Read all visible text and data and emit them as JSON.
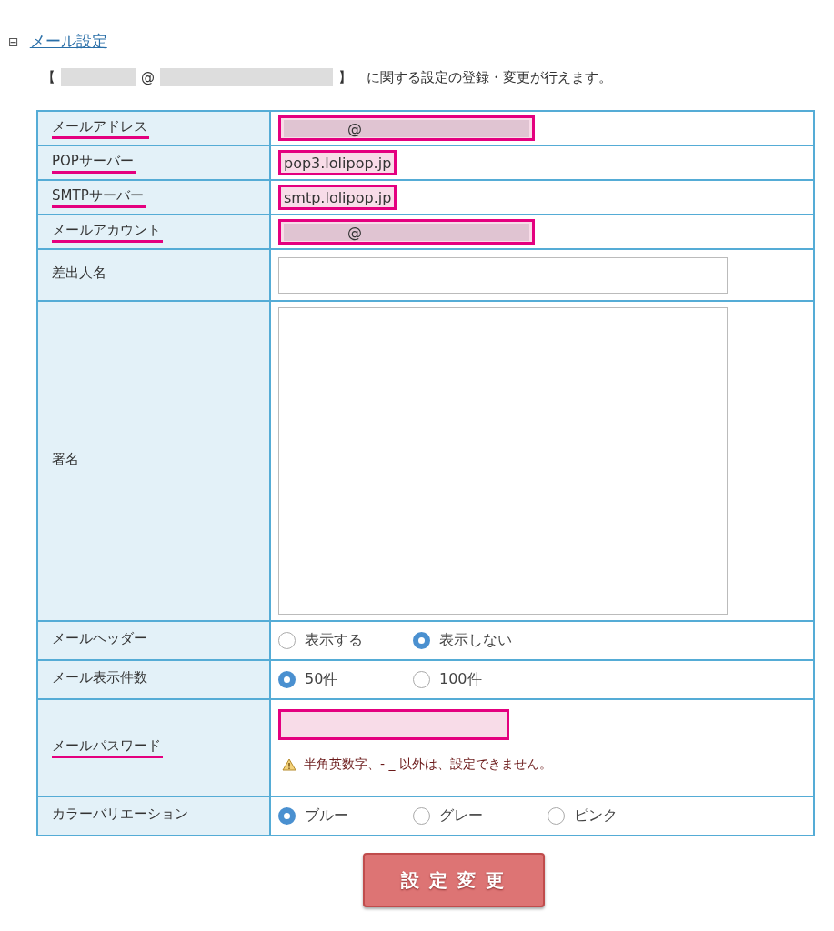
{
  "section": {
    "toggle": "⊟",
    "title": "メール設定"
  },
  "intro": {
    "open": "【",
    "address": "@",
    "close": "】",
    "text": "に関する設定の登録・変更が行えます。"
  },
  "rows": [
    {
      "label": "メールアドレス",
      "underlined": true,
      "kind": "value",
      "value": "@",
      "redacted": true,
      "highlighted": true
    },
    {
      "label": "POPサーバー",
      "underlined": true,
      "kind": "value",
      "value": "pop3.lolipop.jp",
      "redacted": false,
      "highlighted": true
    },
    {
      "label": "SMTPサーバー",
      "underlined": true,
      "kind": "value",
      "value": "smtp.lolipop.jp",
      "redacted": false,
      "highlighted": true
    },
    {
      "label": "メールアカウント",
      "underlined": true,
      "kind": "value",
      "value": "@",
      "redacted": true,
      "highlighted": true
    },
    {
      "label": "差出人名",
      "underlined": false,
      "kind": "input"
    },
    {
      "label": "署名",
      "underlined": false,
      "kind": "textarea"
    },
    {
      "label": "メールヘッダー",
      "underlined": false,
      "kind": "radio",
      "options": [
        {
          "label": "表示する",
          "selected": false
        },
        {
          "label": "表示しない",
          "selected": true
        }
      ]
    },
    {
      "label": "メール表示件数",
      "underlined": false,
      "kind": "radio",
      "options": [
        {
          "label": "50件",
          "selected": true
        },
        {
          "label": "100件",
          "selected": false
        }
      ]
    },
    {
      "label": "メールパスワード",
      "underlined": true,
      "kind": "password",
      "highlighted": true,
      "note": "半角英数字、- _ 以外は、設定できません。"
    },
    {
      "label": "カラーバリエーション",
      "underlined": false,
      "kind": "radio",
      "options": [
        {
          "label": "ブルー",
          "selected": true
        },
        {
          "label": "グレー",
          "selected": false
        },
        {
          "label": "ピンク",
          "selected": false
        }
      ]
    }
  ],
  "submit": "設 定 変 更"
}
